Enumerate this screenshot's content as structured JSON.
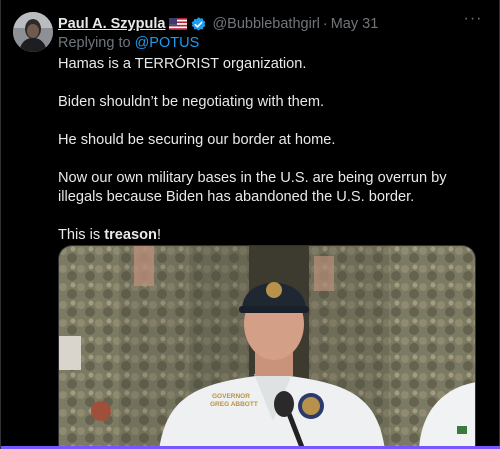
{
  "author": {
    "display_name": "Paul A. Szypula",
    "handle": "@Bubblebathgirl",
    "date": "May 31",
    "flag_icon": "us-flag-icon",
    "verified_icon": "verified-badge-icon"
  },
  "reply": {
    "prefix": "Replying to",
    "mention": "@POTUS"
  },
  "tweet": {
    "p1": "Hamas is a TERRÓRIST organization.",
    "p2": "Biden shouldn’t be negotiating with them.",
    "p3": "He should be securing our border at home.",
    "p4": "Now our own military bases in the U.S. are being overrun by illegals because Biden has abandoned the U.S. border.",
    "p5_prefix": "This is ",
    "p5_bold": "treason",
    "p5_suffix": "!"
  },
  "media": {
    "shirt_text_line1": "GOVERNOR",
    "shirt_text_line2": "GREG ABBOTT"
  },
  "menu": {
    "more_label": "···"
  },
  "colors": {
    "background": "#000000",
    "text": "#e7e9ea",
    "muted": "#71767b",
    "link": "#1d9bf0",
    "accent_bar": "#7856ff"
  }
}
